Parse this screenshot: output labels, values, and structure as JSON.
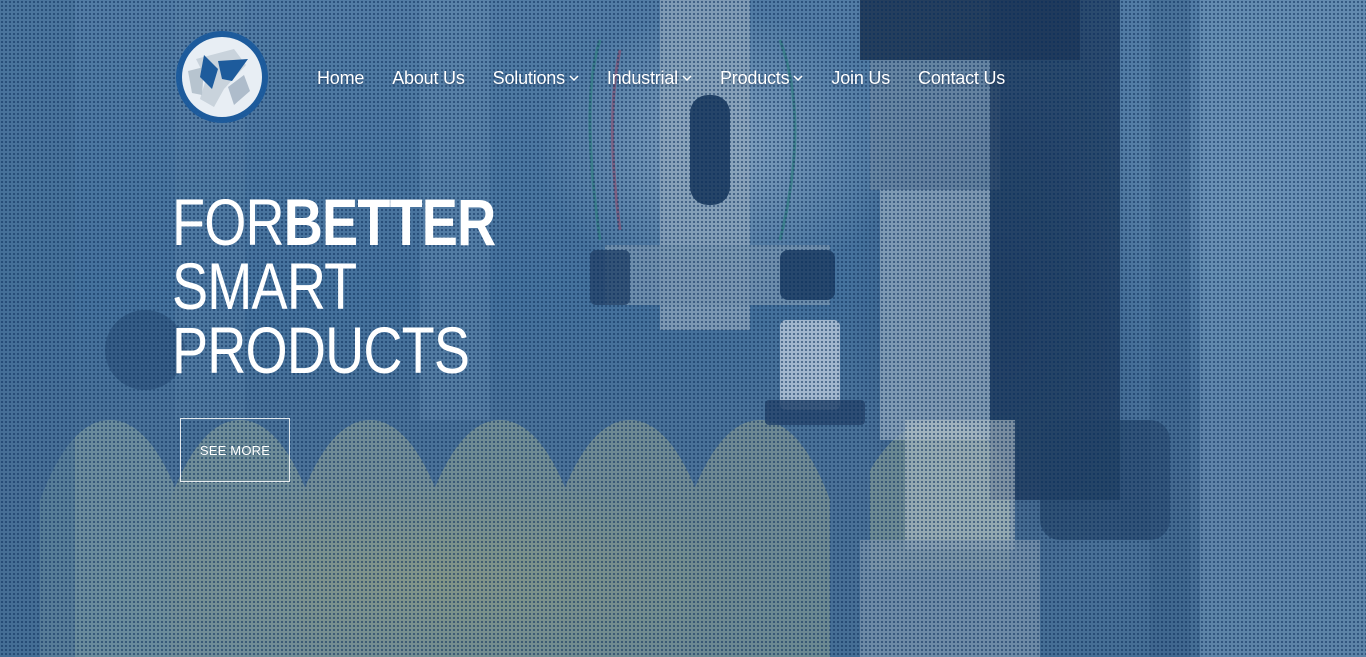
{
  "colors": {
    "overlay_blue": "#1e4f86",
    "logo_blue": "#1d5b9c",
    "text": "#ffffff"
  },
  "logo": {
    "icon": "company-logo-icon"
  },
  "nav": {
    "items": [
      {
        "label": "Home",
        "has_dropdown": false
      },
      {
        "label": "About Us",
        "has_dropdown": false
      },
      {
        "label": "Solutions",
        "has_dropdown": true
      },
      {
        "label": "Industrial",
        "has_dropdown": true
      },
      {
        "label": "Products",
        "has_dropdown": true
      },
      {
        "label": "Join Us",
        "has_dropdown": false
      },
      {
        "label": "Contact Us",
        "has_dropdown": false
      }
    ],
    "dropdown_icon": "chevron-down-icon"
  },
  "hero": {
    "line1_light": "FOR",
    "line1_bold": "BETTER",
    "line2": "SMART",
    "line3": "PRODUCTS",
    "cta_label": "SEE MORE",
    "background": "industrial bottling machine"
  }
}
